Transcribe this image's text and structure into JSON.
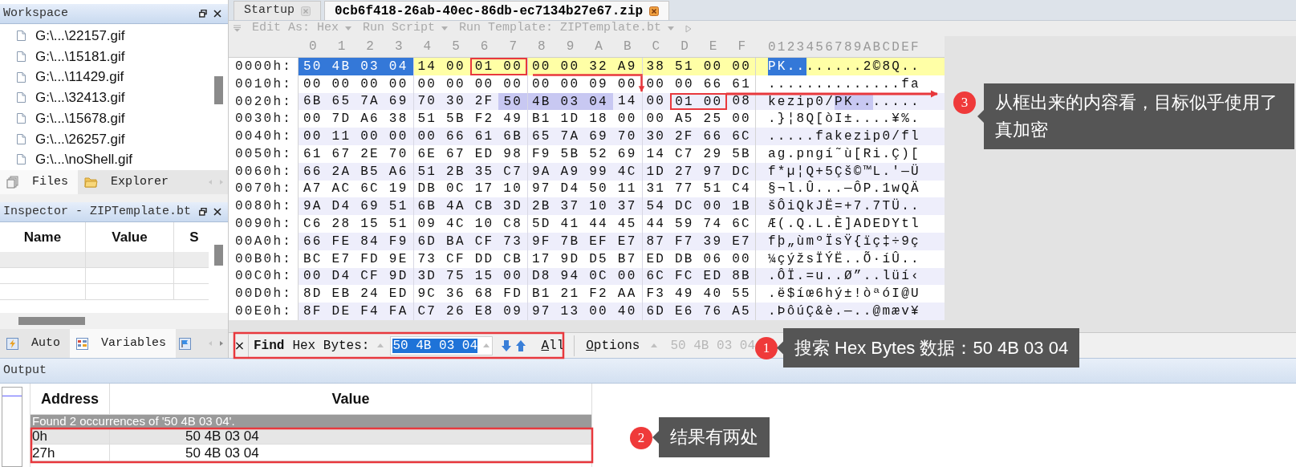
{
  "workspace": {
    "title": "Workspace",
    "files": [
      "G:\\...\\22157.gif",
      "G:\\...\\15181.gif",
      "G:\\...\\11429.gif",
      "G:\\...\\32413.gif",
      "G:\\...\\15678.gif",
      "G:\\...\\26257.gif",
      "G:\\...\\noShell.gif"
    ],
    "tabs": [
      {
        "label": "Files",
        "selected": true
      },
      {
        "label": "Explorer",
        "selected": false
      }
    ]
  },
  "inspector": {
    "title": "Inspector - ZIPTemplate.bt",
    "columns": [
      "Name",
      "Value",
      "S"
    ],
    "tabs": [
      {
        "label": "Auto",
        "selected": false
      },
      {
        "label": "Variables",
        "selected": true
      }
    ]
  },
  "editor": {
    "tabs": [
      {
        "label": "Startup",
        "selected": false
      },
      {
        "label": "0cb6f418-26ab-40ec-86db-ec7134b27e67.zip",
        "selected": true
      }
    ],
    "toolbar": [
      "Edit As: Hex",
      "Run Script",
      "Run Template: ZIPTemplate.bt"
    ],
    "columns": [
      "0",
      "1",
      "2",
      "3",
      "4",
      "5",
      "6",
      "7",
      "8",
      "9",
      "A",
      "B",
      "C",
      "D",
      "E",
      "F"
    ],
    "text_header": "0123456789ABCDEF",
    "rows": [
      {
        "address": "0000h:",
        "current": true,
        "segments": [
          {
            "kind": "selection",
            "hex": "50 4B 03 04",
            "text": "PK.."
          },
          {
            "kind": "plain",
            "hex": "14 00",
            "text": ".."
          },
          {
            "kind": "plain",
            "hex": "01 00",
            "text": "..",
            "boxed": true
          },
          {
            "kind": "plain",
            "hex": "00 00 32 A9 38 51 00 00",
            "text": "..2©8Q.."
          }
        ]
      },
      {
        "address": "0010h:",
        "current": false,
        "segments": [
          {
            "kind": "plain",
            "hex": "00 00 00 00 00 00 00 00 00 00 09 00",
            "text": "............"
          },
          {
            "kind": "plain",
            "hex": "00 00 66 61",
            "text": "..fa"
          }
        ]
      },
      {
        "address": "0020h:",
        "current": false,
        "segments": [
          {
            "kind": "plain",
            "hex": "6B 65 7A 69 70 30 2F",
            "text": "kezip0/"
          },
          {
            "kind": "match",
            "hex": "50 4B 03 04",
            "text": "PK.."
          },
          {
            "kind": "plain",
            "hex": "14 00",
            "text": ".."
          },
          {
            "kind": "plain",
            "hex": "01 00",
            "text": "..",
            "boxed": true
          },
          {
            "kind": "plain",
            "hex": "08",
            "text": "."
          }
        ]
      },
      {
        "address": "0030h:",
        "current": false,
        "segments": [
          {
            "kind": "plain",
            "hex": "00 7D A6 38 51 5B F2 49 B1 1D 18 00 00 A5 25 00",
            "text": ".}¦8Q[òI±....¥%."
          }
        ]
      },
      {
        "address": "0040h:",
        "current": false,
        "segments": [
          {
            "kind": "plain",
            "hex": "00 11 00 00 00 66 61 6B 65 7A 69 70 30 2F 66 6C",
            "text": ".....fakezip0/fl"
          }
        ]
      },
      {
        "address": "0050h:",
        "current": false,
        "segments": [
          {
            "kind": "plain",
            "hex": "61 67 2E 70 6E 67 ED 98 F9 5B 52 69 14 C7 29 5B",
            "text": "ag.pngí˜ù[Ri.Ç)["
          }
        ]
      },
      {
        "address": "0060h:",
        "current": false,
        "segments": [
          {
            "kind": "plain",
            "hex": "66 2A B5 A6 51 2B 35 C7 9A A9 99 4C 1D 27 97 DC",
            "text": "f*µ¦Q+5Çš©™L.'—Ü"
          }
        ]
      },
      {
        "address": "0070h:",
        "current": false,
        "segments": [
          {
            "kind": "plain",
            "hex": "A7 AC 6C 19 DB 0C 17 10 97 D4 50 11 31 77 51 C4",
            "text": "§¬l.Û...—ÔP.1wQÄ"
          }
        ]
      },
      {
        "address": "0080h:",
        "current": false,
        "segments": [
          {
            "kind": "plain",
            "hex": "9A D4 69 51 6B 4A CB 3D 2B 37 10 37 54 DC 00 1B",
            "text": "šÔiQkJË=+7.7TÜ.."
          }
        ]
      },
      {
        "address": "0090h:",
        "current": false,
        "segments": [
          {
            "kind": "plain",
            "hex": "C6 28 15 51 09 4C 10 C8 5D 41 44 45 44 59 74 6C",
            "text": "Æ(.Q.L.È]ADEDYtl"
          }
        ]
      },
      {
        "address": "00A0h:",
        "current": false,
        "segments": [
          {
            "kind": "plain",
            "hex": "66 FE 84 F9 6D BA CF 73 9F 7B EF E7 87 F7 39 E7",
            "text": "fþ„ùmºÏsŸ{ïç‡÷9ç"
          }
        ]
      },
      {
        "address": "00B0h:",
        "current": false,
        "segments": [
          {
            "kind": "plain",
            "hex": "BC E7 FD 9E 73 CF DD CB 17 9D D5 B7 ED DB 06 00",
            "text": "¼çýžsÏÝË..Õ·íÛ.."
          }
        ]
      },
      {
        "address": "00C0h:",
        "current": false,
        "segments": [
          {
            "kind": "plain",
            "hex": "00 D4 CF 9D 3D 75 15 00 D8 94 0C 00 6C FC ED 8B",
            "text": ".ÔÏ.=u..Ø”..lüí‹"
          }
        ]
      },
      {
        "address": "00D0h:",
        "current": false,
        "segments": [
          {
            "kind": "plain",
            "hex": "8D EB 24 ED 9C 36 68 FD B1 21 F2 AA F3 49 40 55",
            "text": ".ë$íœ6hý±!òªóI@U"
          }
        ]
      },
      {
        "address": "00E0h:",
        "current": false,
        "segments": [
          {
            "kind": "plain",
            "hex": "8F DE F4 FA C7 26 E8 09 97 13 00 40 6D E6 76 A5",
            "text": ".ÞôúÇ&è.—..@mæv¥"
          }
        ]
      }
    ]
  },
  "find_bar": {
    "close": "×",
    "label": "Find",
    "mode": "Hex Bytes:",
    "value": "50 4B 03 04",
    "all": "All",
    "options": "Options",
    "history": "50 4B 03 04"
  },
  "output": {
    "title": "Output",
    "columns": [
      "Address",
      "Value"
    ],
    "message": "Found 2 occurrences of '50 4B 03 04'.",
    "rows": [
      {
        "address": "0h",
        "value": "50 4B 03 04",
        "selected": true
      },
      {
        "address": "27h",
        "value": "50 4B 03 04",
        "selected": false
      }
    ]
  },
  "callouts": [
    {
      "number": "1",
      "text": "搜索 Hex Bytes 数据：50 4B 03 04"
    },
    {
      "number": "2",
      "text": "结果有两处"
    },
    {
      "number": "3",
      "text": "从框出来的内容看，目标似乎使用了真加密"
    }
  ]
}
